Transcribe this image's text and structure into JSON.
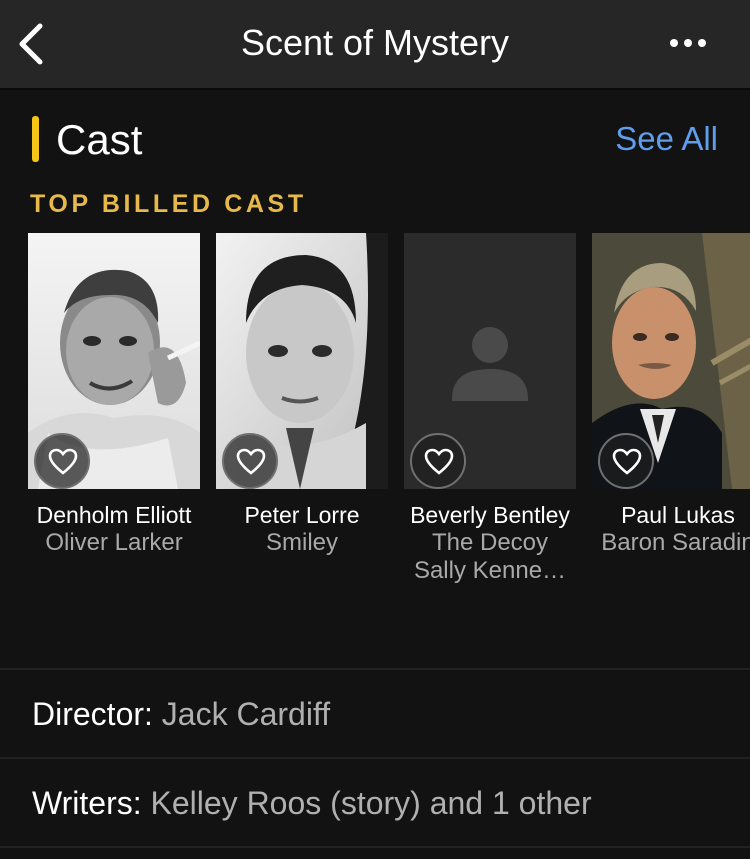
{
  "nav": {
    "title": "Scent of Mystery",
    "back_icon": "chevron-left-icon",
    "more_icon": "more-horizontal-icon"
  },
  "cast_section": {
    "title": "Cast",
    "see_all": "See All",
    "subheader": "TOP BILLED CAST",
    "accent_color": "#f5c518",
    "link_color": "#5f9ded",
    "members": [
      {
        "name": "Denholm Elliott",
        "role": "Oliver Larker",
        "has_photo": true
      },
      {
        "name": "Peter Lorre",
        "role": "Smiley",
        "has_photo": true
      },
      {
        "name": "Beverly Bentley",
        "role": "The Decoy Sally Kenne…",
        "has_photo": false,
        "placeholder_icon": "person-placeholder-icon"
      },
      {
        "name": "Paul Lukas",
        "role": "Baron Saradin",
        "has_photo": true
      }
    ],
    "favorite_icon": "heart-outline-icon"
  },
  "credits": {
    "director_label": "Director:",
    "director_value": "Jack Cardiff",
    "writers_label": "Writers:",
    "writers_value": "Kelley Roos (story) and 1 other"
  }
}
